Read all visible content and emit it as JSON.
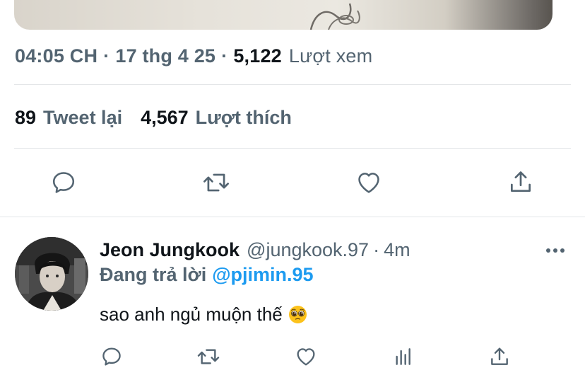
{
  "tweet": {
    "time": "04:05 CH",
    "date": "17 thg 4 25",
    "views_count": "5,122",
    "views_label": "Lượt xem",
    "retweets_count": "89",
    "retweets_label": "Tweet lại",
    "likes_count": "4,567",
    "likes_label": "Lượt thích"
  },
  "actions": [
    "reply-icon",
    "retweet-icon",
    "like-icon",
    "share-icon"
  ],
  "reply": {
    "author_name": "Jeon Jungkook",
    "author_handle": "@jungkook.97",
    "time": "4m",
    "replying_prefix": "Đang trả lời",
    "replying_to": "@pjimin.95",
    "text": "sao anh ngủ muộn thế",
    "emoji": "pleading-face",
    "actions": [
      "reply-icon",
      "retweet-icon",
      "like-icon",
      "analytics-icon",
      "share-icon"
    ]
  },
  "colors": {
    "secondary_text": "#536471",
    "primary_text": "#0f1419",
    "link": "#1d9bf0",
    "divider": "#e3e6e8"
  }
}
